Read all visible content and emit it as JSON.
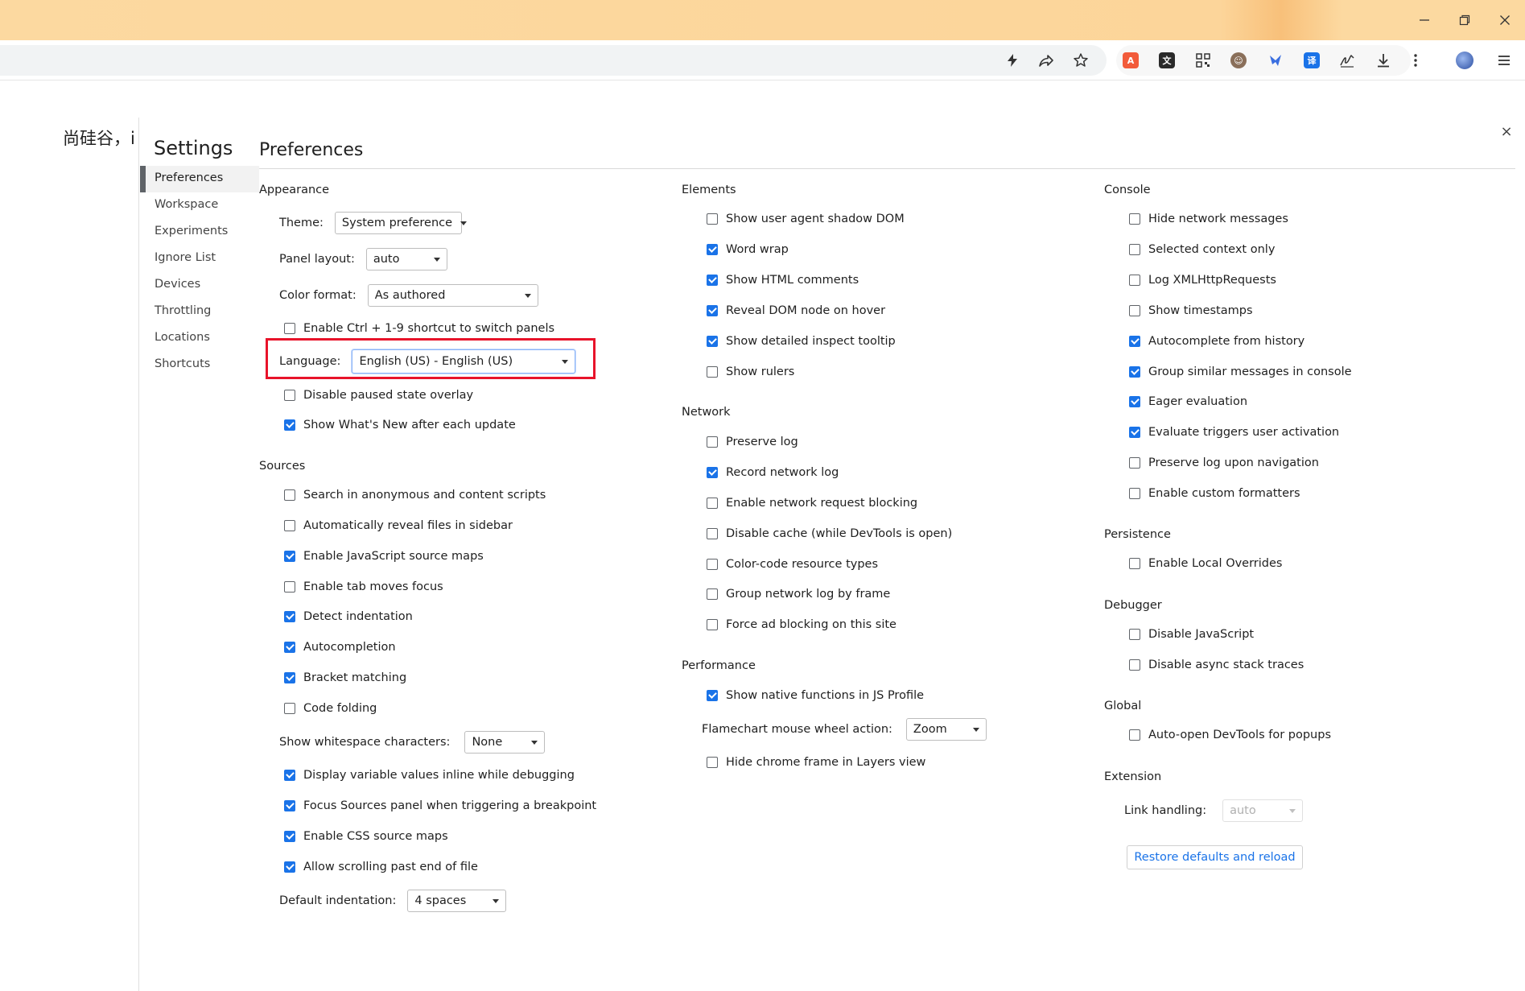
{
  "page_text": "尚硅谷，i",
  "settings_title": "Settings",
  "close_label": "×",
  "nav": [
    {
      "label": "Preferences",
      "active": true
    },
    {
      "label": "Workspace"
    },
    {
      "label": "Experiments"
    },
    {
      "label": "Ignore List"
    },
    {
      "label": "Devices"
    },
    {
      "label": "Throttling"
    },
    {
      "label": "Locations"
    },
    {
      "label": "Shortcuts"
    }
  ],
  "preferences_title": "Preferences",
  "appearance": {
    "title": "Appearance",
    "theme_label": "Theme:",
    "theme_value": "System preference",
    "panel_layout_label": "Panel layout:",
    "panel_layout_value": "auto",
    "color_format_label": "Color format:",
    "color_format_value": "As authored",
    "ctrl_shortcut": "Enable Ctrl + 1-9 shortcut to switch panels",
    "language_label": "Language:",
    "language_value": "English (US) - English (US)",
    "paused_overlay": "Disable paused state overlay",
    "whats_new": "Show What's New after each update"
  },
  "sources": {
    "title": "Sources",
    "items": [
      {
        "label": "Search in anonymous and content scripts",
        "checked": false
      },
      {
        "label": "Automatically reveal files in sidebar",
        "checked": false
      },
      {
        "label": "Enable JavaScript source maps",
        "checked": true
      },
      {
        "label": "Enable tab moves focus",
        "checked": false
      },
      {
        "label": "Detect indentation",
        "checked": true
      },
      {
        "label": "Autocompletion",
        "checked": true
      },
      {
        "label": "Bracket matching",
        "checked": true
      },
      {
        "label": "Code folding",
        "checked": false
      }
    ],
    "whitespace_label": "Show whitespace characters:",
    "whitespace_value": "None",
    "items2": [
      {
        "label": "Display variable values inline while debugging",
        "checked": true
      },
      {
        "label": "Focus Sources panel when triggering a breakpoint",
        "checked": true
      },
      {
        "label": "Enable CSS source maps",
        "checked": true
      },
      {
        "label": "Allow scrolling past end of file",
        "checked": true
      }
    ],
    "indentation_label": "Default indentation:",
    "indentation_value": "4 spaces"
  },
  "elements": {
    "title": "Elements",
    "items": [
      {
        "label": "Show user agent shadow DOM",
        "checked": false
      },
      {
        "label": "Word wrap",
        "checked": true
      },
      {
        "label": "Show HTML comments",
        "checked": true
      },
      {
        "label": "Reveal DOM node on hover",
        "checked": true
      },
      {
        "label": "Show detailed inspect tooltip",
        "checked": true
      },
      {
        "label": "Show rulers",
        "checked": false
      }
    ]
  },
  "network": {
    "title": "Network",
    "items": [
      {
        "label": "Preserve log",
        "checked": false
      },
      {
        "label": "Record network log",
        "checked": true
      },
      {
        "label": "Enable network request blocking",
        "checked": false
      },
      {
        "label": "Disable cache (while DevTools is open)",
        "checked": false
      },
      {
        "label": "Color-code resource types",
        "checked": false
      },
      {
        "label": "Group network log by frame",
        "checked": false
      },
      {
        "label": "Force ad blocking on this site",
        "checked": false
      }
    ]
  },
  "performance": {
    "title": "Performance",
    "native_functions": "Show native functions in JS Profile",
    "flamechart_label": "Flamechart mouse wheel action:",
    "flamechart_value": "Zoom",
    "hide_chrome_frame": "Hide chrome frame in Layers view"
  },
  "console": {
    "title": "Console",
    "items": [
      {
        "label": "Hide network messages",
        "checked": false
      },
      {
        "label": "Selected context only",
        "checked": false
      },
      {
        "label": "Log XMLHttpRequests",
        "checked": false
      },
      {
        "label": "Show timestamps",
        "checked": false
      },
      {
        "label": "Autocomplete from history",
        "checked": true
      },
      {
        "label": "Group similar messages in console",
        "checked": true
      },
      {
        "label": "Eager evaluation",
        "checked": true
      },
      {
        "label": "Evaluate triggers user activation",
        "checked": true
      },
      {
        "label": "Preserve log upon navigation",
        "checked": false
      },
      {
        "label": "Enable custom formatters",
        "checked": false
      }
    ]
  },
  "persistence": {
    "title": "Persistence",
    "local_overrides": "Enable Local Overrides"
  },
  "debugger": {
    "title": "Debugger",
    "disable_js": "Disable JavaScript",
    "disable_async": "Disable async stack traces"
  },
  "global": {
    "title": "Global",
    "auto_open": "Auto-open DevTools for popups"
  },
  "extension": {
    "title": "Extension",
    "link_handling_label": "Link handling:",
    "link_handling_value": "auto"
  },
  "restore_label": "Restore defaults and reload",
  "colors": {
    "accent": "#1a73e8",
    "highlight": "#e8132a",
    "titlebar": "#fcd9a0"
  }
}
